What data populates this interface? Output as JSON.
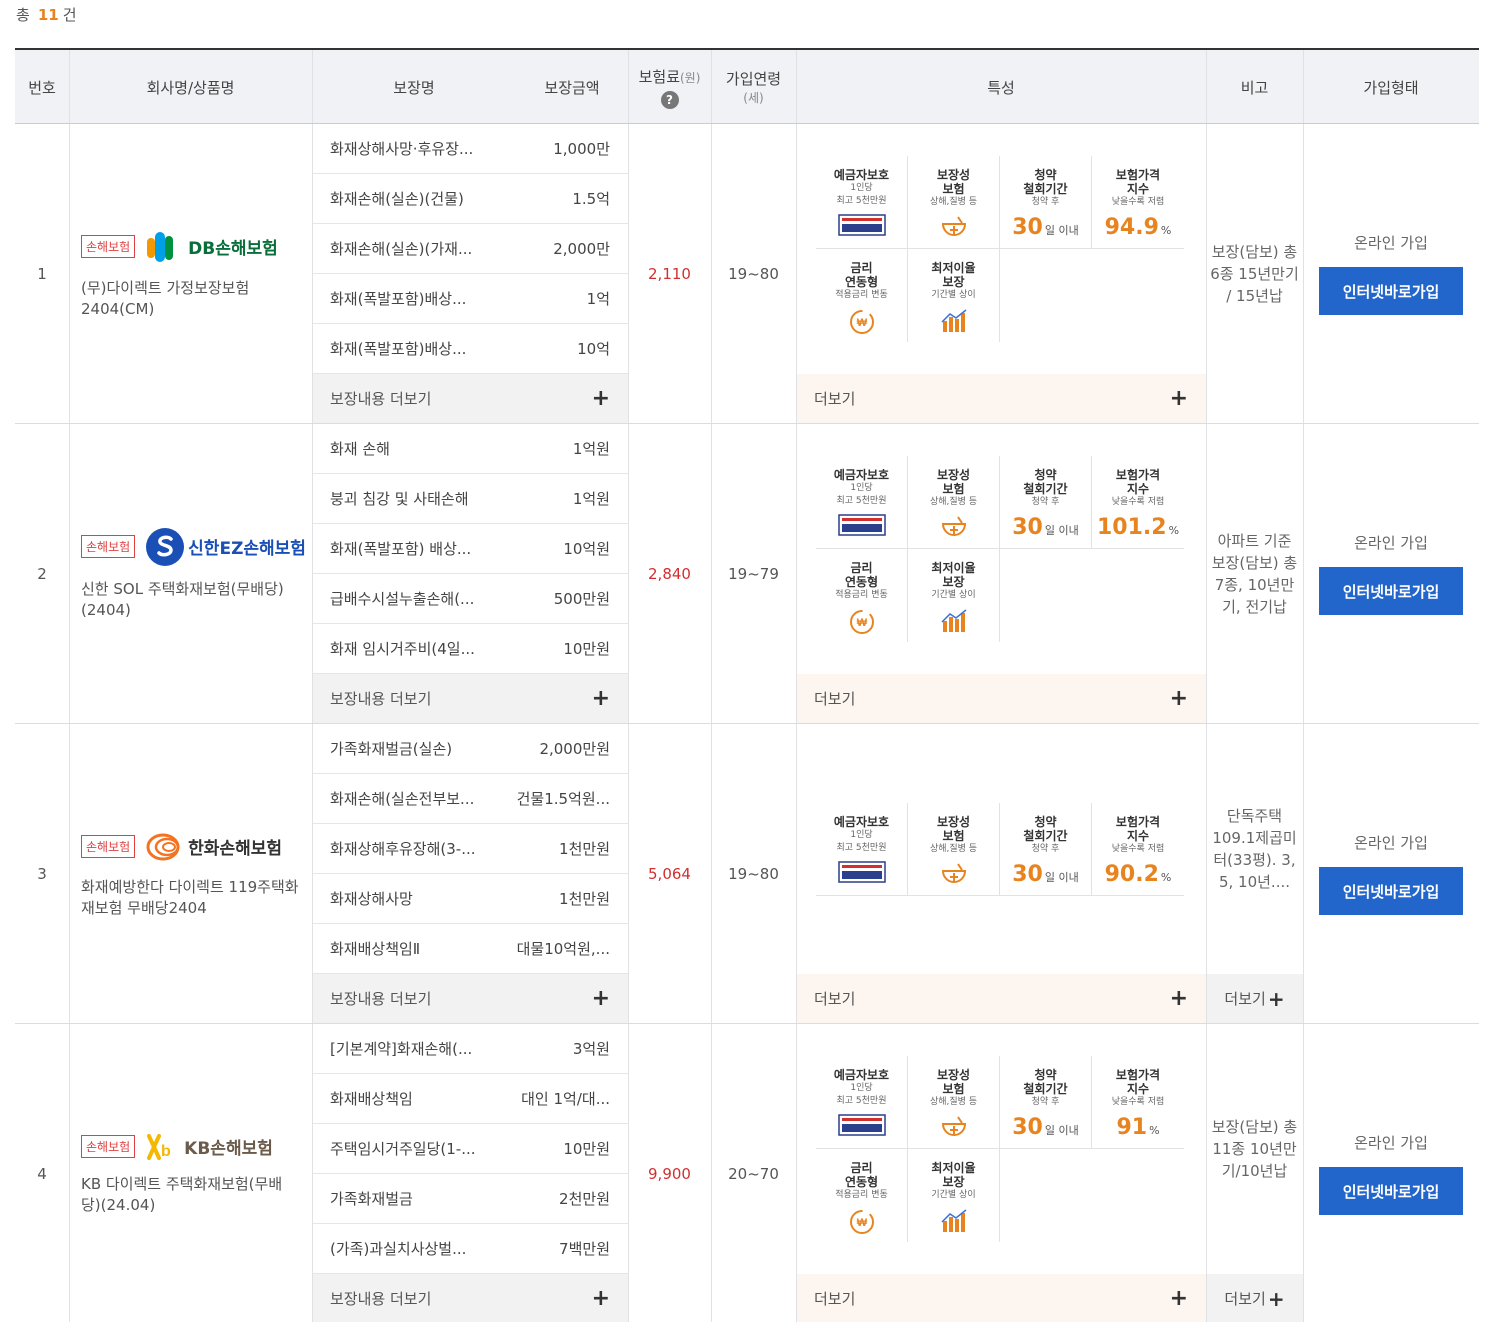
{
  "summary": {
    "prefix": "총",
    "count": "11",
    "suffix": "건"
  },
  "headers": {
    "num": "번호",
    "product": "회사명/상품명",
    "coverage_name": "보장명",
    "coverage_amount": "보장금액",
    "premium": "보험료",
    "premium_unit": "(원)",
    "age": "가입연령",
    "age_unit": "(세)",
    "features": "특성",
    "note": "비고",
    "join": "가입형태"
  },
  "labels": {
    "badge": "손해보험",
    "coverage_more": "보장내용 더보기",
    "feature_more": "더보기",
    "note_more": "더보기",
    "join_type": "온라인 가입",
    "join_button": "인터넷바로가입"
  },
  "features": {
    "deposit": {
      "title1": "예금자보호",
      "sub1": "1인당",
      "sub2": "최고 5천만원",
      "icon": "deposit-protection-icon"
    },
    "nature": {
      "title1": "보장성",
      "title2": "보험",
      "sub1": "상해,질병 등",
      "icon": "protection-bowl-icon"
    },
    "cancel": {
      "title1": "청약",
      "title2": "철회기간",
      "sub1": "청약 후",
      "value": "30",
      "unit": "일 이내"
    },
    "price": {
      "title1": "보험가격",
      "title2": "지수",
      "sub1": "낮을수록 저렴",
      "unit": "%"
    },
    "rate": {
      "title1": "금리",
      "title2": "연동형",
      "sub1": "적용금리 변동",
      "icon": "rate-linked-icon"
    },
    "min_rate": {
      "title1": "최저이율",
      "title2": "보장",
      "sub1": "기간별 상이",
      "icon": "min-rate-chart-icon"
    }
  },
  "rows": [
    {
      "num": "1",
      "company": "DB손해보험",
      "product": "(무)다이렉트 가정보장보험 2404(CM)",
      "coverages": [
        {
          "name": "화재상해사망·후유장...",
          "amount": "1,000만"
        },
        {
          "name": "화재손해(실손)(건물)",
          "amount": "1.5억"
        },
        {
          "name": "화재손해(실손)(가재...",
          "amount": "2,000만"
        },
        {
          "name": "화재(폭발포함)배상...",
          "amount": "1억"
        },
        {
          "name": "화재(폭발포함)배상...",
          "amount": "10억"
        }
      ],
      "premium": "2,110",
      "age": "19~80",
      "price_index": "94.9",
      "note": "보장(담보) 총 6종 15년만기 / 15년납",
      "note_more": false
    },
    {
      "num": "2",
      "company": "신한EZ손해보험",
      "product": "신한 SOL 주택화재보험(무배당)(2404)",
      "coverages": [
        {
          "name": "화재 손해",
          "amount": "1억원"
        },
        {
          "name": "붕괴 침강 및 사태손해",
          "amount": "1억원"
        },
        {
          "name": "화재(폭발포함) 배상...",
          "amount": "10억원"
        },
        {
          "name": "급배수시설누출손해(...",
          "amount": "500만원"
        },
        {
          "name": "화재 임시거주비(4일...",
          "amount": "10만원"
        }
      ],
      "premium": "2,840",
      "age": "19~79",
      "price_index": "101.2",
      "note": "아파트 기준 보장(담보) 총 7종, 10년만기, 전기납",
      "note_more": false
    },
    {
      "num": "3",
      "company": "한화손해보험",
      "product": "화재예방한다 다이렉트 119주택화재보험 무배당2404",
      "coverages": [
        {
          "name": "가족화재벌금(실손)",
          "amount": "2,000만원"
        },
        {
          "name": "화재손해(실손전부보...",
          "amount": "건물1.5억원..."
        },
        {
          "name": "화재상해후유장해(3-...",
          "amount": "1천만원"
        },
        {
          "name": "화재상해사망",
          "amount": "1천만원"
        },
        {
          "name": "화재배상책임Ⅱ",
          "amount": "대물10억원,..."
        }
      ],
      "premium": "5,064",
      "age": "19~80",
      "price_index": "90.2",
      "note": "단독주택 109.1제곱미터(33평). 3, 5, 10년....",
      "note_more": true
    },
    {
      "num": "4",
      "company": "KB손해보험",
      "product": "KB 다이렉트 주택화재보험(무배당)(24.04)",
      "coverages": [
        {
          "name": "[기본계약]화재손해(...",
          "amount": "3억원"
        },
        {
          "name": "화재배상책임",
          "amount": "대인 1억/대..."
        },
        {
          "name": "주택임시거주일당(1-...",
          "amount": "10만원"
        },
        {
          "name": "가족화재벌금",
          "amount": "2천만원"
        },
        {
          "name": "(가족)과실치사상벌...",
          "amount": "7백만원"
        }
      ],
      "premium": "9,900",
      "age": "20~70",
      "price_index": "91",
      "note": "보장(담보) 총 11종 10년만기/10년납",
      "note_more": true
    }
  ],
  "colors": {
    "accent_orange": "#e8841f",
    "premium_red": "#d32f2f",
    "button_blue": "#2266cc",
    "badge_red": "#e04040"
  }
}
